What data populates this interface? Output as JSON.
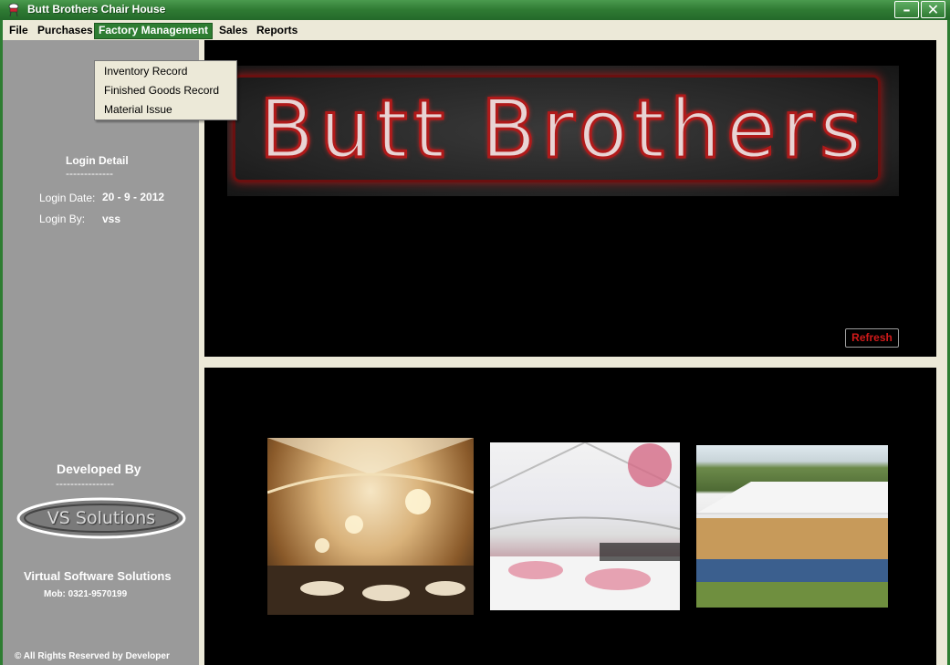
{
  "window": {
    "title": "Butt Brothers Chair House",
    "minimize_glyph": "–",
    "close_glyph": "✕"
  },
  "menubar": {
    "items": [
      {
        "label": "File"
      },
      {
        "label": "Purchases"
      },
      {
        "label": "Factory Management",
        "active": true
      },
      {
        "label": "Sales"
      },
      {
        "label": "Reports"
      }
    ]
  },
  "dropdown": {
    "items": [
      {
        "label": "Inventory Record"
      },
      {
        "label": "Finished Goods Record"
      },
      {
        "label": "Material Issue"
      }
    ]
  },
  "sidebar": {
    "login_heading": "Login Detail",
    "login_divider": "-------------",
    "login_date_label": "Login Date:",
    "login_date_value": "20 - 9 - 2012",
    "login_by_label": "Login By:",
    "login_by_value": "vss",
    "developed_by_heading": "Developed By",
    "developed_divider": "----------------",
    "dev_logo_text": "VS Solutions",
    "company_name": "Virtual Software Solutions",
    "mobile": "Mob: 0321-9570199",
    "copyright": "© All Rights Reserved by Developer"
  },
  "banner": {
    "logo_text": "Butt Brothers"
  },
  "refresh_button": {
    "label": "Refresh"
  },
  "colors": {
    "title_bar": "#2e7d32",
    "sidebar": "#9a9a9a",
    "panel": "#000000",
    "accent_red": "#d11a1a"
  },
  "icons": {
    "app_icon": "chair-app-icon"
  }
}
